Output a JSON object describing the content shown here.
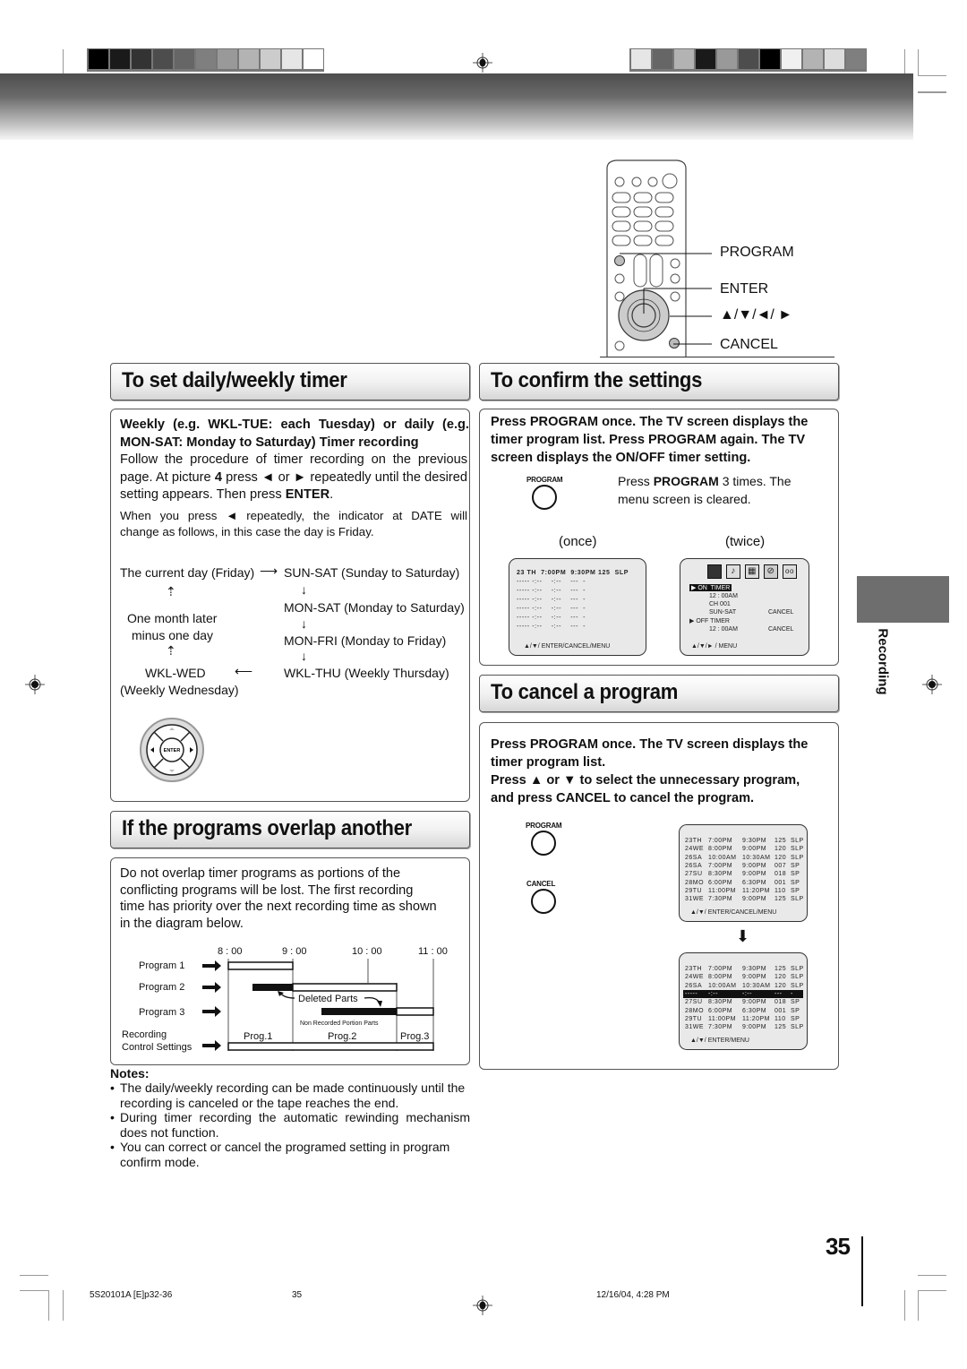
{
  "remote": {
    "labels": [
      "PROGRAM",
      "ENTER",
      "▲/▼/◄/ ►",
      "CANCEL"
    ]
  },
  "set_timer": {
    "title": "To set daily/weekly timer",
    "heading_line1": "Weekly (e.g. WKL-TUE: each Tuesday) or daily (e.g.",
    "heading_line2": "MON-SAT: Monday to Saturday) Timer recording",
    "para1_line1": "Follow the procedure of timer recording on the previous",
    "para1_line2_a": "page. At picture ",
    "para1_line2_b": "4",
    "para1_line2_c": " press ◄ or ► repeatedly until the desired",
    "para1_line3_a": "setting appears. Then press ",
    "para1_line3_b": "ENTER",
    "para1_line3_c": ".",
    "para2_line1": "When you press ◄ repeatedly, the indicator at DATE will",
    "para2_line2": "change as follows, in this case the day is Friday.",
    "flow": {
      "current_day": "The current day (Friday)",
      "sun_sat": "SUN-SAT (Sunday to Saturday)",
      "mon_sat": "MON-SAT (Monday to Saturday)",
      "mon_fri": "MON-FRI (Monday to Friday)",
      "wkl_thu": "WKL-THU (Weekly Thursday)",
      "wkl_wed": "WKL-WED",
      "wkl_wed_desc": "(Weekly Wednesday)",
      "one_month_1": "One month later",
      "one_month_2": "minus one day"
    },
    "enter_button": "ENTER"
  },
  "overlap": {
    "title": "If the programs overlap another",
    "text_lines": [
      "Do not overlap timer programs as portions of the",
      "conflicting programs will be lost. The first recording",
      "time has priority over the next recording time as shown",
      "in the diagram below."
    ],
    "diagram": {
      "times": [
        "8 : 00",
        "9 : 00",
        "10 : 00",
        "11 : 00"
      ],
      "rows": [
        "Program 1",
        "Program 2",
        "Program 3"
      ],
      "recording_label_1": "Recording",
      "recording_label_2": "Control Settings",
      "deleted_parts": "Deleted Parts",
      "non_recorded": "Non Recorded Portion Parts",
      "segments": [
        "Prog.1",
        "Prog.2",
        "Prog.3"
      ]
    }
  },
  "notes": {
    "title": "Notes:",
    "items": [
      [
        "The daily/weekly recording can be made continuously until the",
        "recording is canceled or the tape reaches the end."
      ],
      [
        "During timer recording the automatic rewinding mechanism",
        "does not function."
      ],
      [
        "You can correct or cancel the programed setting in program",
        "confirm mode."
      ]
    ]
  },
  "confirm": {
    "title": "To confirm the settings",
    "lines": [
      "Press PROGRAM once. The TV screen displays the",
      "timer program list. Press PROGRAM again. The TV",
      "screen displays the ON/OFF timer setting."
    ],
    "program_button": "PROGRAM",
    "press_a": "Press ",
    "press_b": "PROGRAM",
    "press_c": " 3 times. The",
    "press_line2": "menu screen is cleared.",
    "once": "(once)",
    "twice": "(twice)",
    "screen_once": {
      "first_row": "23 TH  7:00PM  9:30PM 125  SLP",
      "empty_row": "----- -:--    -:--    ---  -",
      "footer": "▲/▼/ ENTER/CANCEL/MENU"
    },
    "screen_twice": {
      "on_timer": "ON  TIMER",
      "on_time": "12 : 00AM",
      "channel": "CH 001",
      "days": "SUN-SAT",
      "cancel1": "CANCEL",
      "off_timer": "OFF TIMER",
      "off_time": "12 : 00AM",
      "cancel2": "CANCEL",
      "footer": "▲/▼/► / MENU"
    }
  },
  "cancel": {
    "title": "To cancel a program",
    "lines": [
      "Press PROGRAM once. The TV screen displays the",
      "timer program list.",
      "Press ▲ or ▼ to select the unnecessary program,",
      "and press CANCEL to cancel the program."
    ],
    "program_button": "PROGRAM",
    "cancel_button": "CANCEL",
    "list_before": [
      [
        "23TH",
        "7:00PM",
        "9:30PM",
        "125",
        "SLP"
      ],
      [
        "24WE",
        "8:00PM",
        "9:00PM",
        "120",
        "SLP"
      ],
      [
        "26SA",
        "10:00AM",
        "10:30AM",
        "120",
        "SLP"
      ],
      [
        "26SA",
        "7:00PM",
        "9:00PM",
        "007",
        "SP"
      ],
      [
        "27SU",
        "8:30PM",
        "9:00PM",
        "018",
        "SP"
      ],
      [
        "28MO",
        "6:00PM",
        "6:30PM",
        "001",
        "SP"
      ],
      [
        "29TU",
        "11:00PM",
        "11:20PM",
        "110",
        "SP"
      ],
      [
        "31WE",
        "7:30PM",
        "9:00PM",
        "125",
        "SLP"
      ]
    ],
    "footer_before": "▲/▼/ ENTER/CANCEL/MENU",
    "list_after": [
      [
        "23TH",
        "7:00PM",
        "9:30PM",
        "125",
        "SLP"
      ],
      [
        "24WE",
        "8:00PM",
        "9:00PM",
        "120",
        "SLP"
      ],
      [
        "26SA",
        "10:00AM",
        "10:30AM",
        "120",
        "SLP"
      ],
      [
        "-----",
        "-:--",
        "-:--",
        "---",
        "-"
      ],
      [
        "27SU",
        "8:30PM",
        "9:00PM",
        "018",
        "SP"
      ],
      [
        "28MO",
        "6:00PM",
        "6:30PM",
        "001",
        "SP"
      ],
      [
        "29TU",
        "11:00PM",
        "11:20PM",
        "110",
        "SP"
      ],
      [
        "31WE",
        "7:30PM",
        "9:00PM",
        "125",
        "SLP"
      ]
    ],
    "footer_after": "▲/▼/ ENTER/MENU"
  },
  "side_tab": "Recording",
  "page_number": "35",
  "footer": {
    "doc_code": "5S20101A [E]p32-36",
    "page": "35",
    "date": "12/16/04, 4:28 PM"
  }
}
